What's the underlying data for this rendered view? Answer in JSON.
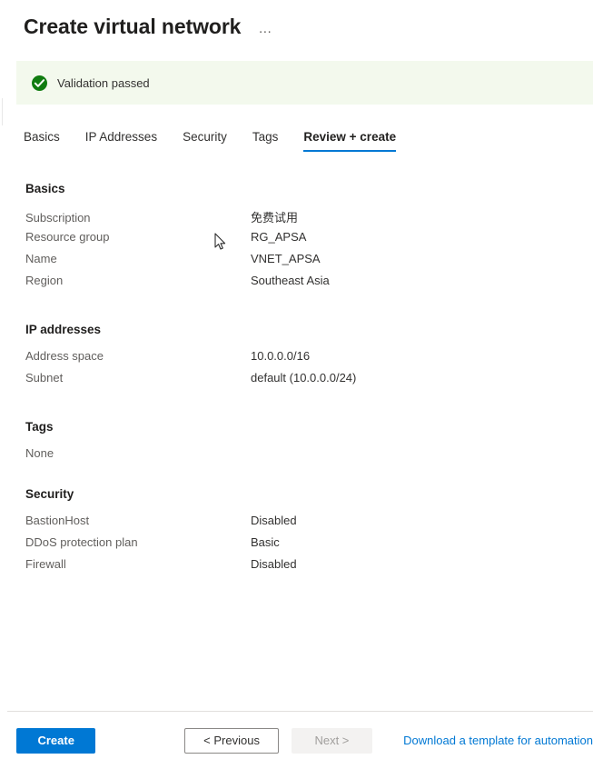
{
  "header": {
    "title": "Create virtual network",
    "more_menu": "…"
  },
  "validation": {
    "icon": "check-circle-icon",
    "message": "Validation passed",
    "status_color": "#107c10",
    "background_color": "#f3f9ed"
  },
  "tabs": [
    {
      "label": "Basics",
      "active": false
    },
    {
      "label": "IP Addresses",
      "active": false
    },
    {
      "label": "Security",
      "active": false
    },
    {
      "label": "Tags",
      "active": false
    },
    {
      "label": "Review + create",
      "active": true
    }
  ],
  "sections": {
    "basics": {
      "title": "Basics",
      "rows": [
        {
          "label": "Subscription",
          "value": "免费试用"
        },
        {
          "label": "Resource group",
          "value": "RG_APSA"
        },
        {
          "label": "Name",
          "value": "VNET_APSA"
        },
        {
          "label": "Region",
          "value": "Southeast Asia"
        }
      ]
    },
    "ip_addresses": {
      "title": "IP addresses",
      "rows": [
        {
          "label": "Address space",
          "value": "10.0.0.0/16"
        },
        {
          "label": "Subnet",
          "value": "default (10.0.0.0/24)"
        }
      ]
    },
    "tags": {
      "title": "Tags",
      "empty_label": "None"
    },
    "security": {
      "title": "Security",
      "rows": [
        {
          "label": "BastionHost",
          "value": "Disabled"
        },
        {
          "label": "DDoS protection plan",
          "value": "Basic"
        },
        {
          "label": "Firewall",
          "value": "Disabled"
        }
      ]
    }
  },
  "footer": {
    "create_label": "Create",
    "previous_label": "< Previous",
    "next_label": "Next >",
    "next_disabled": true,
    "template_link_label": "Download a template for automation",
    "accent_color": "#0078d4"
  }
}
